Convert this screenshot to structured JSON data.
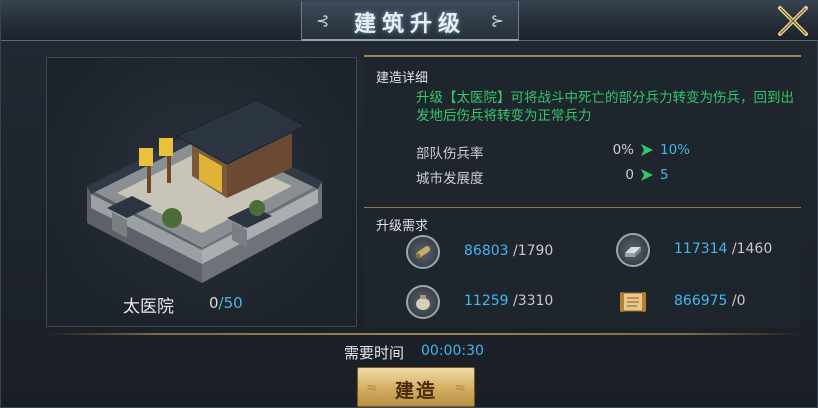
{
  "window": {
    "title": "建筑升级",
    "close_icon": "close-x-icon"
  },
  "building": {
    "name": "太医院",
    "level_current": "0",
    "level_separator": "/",
    "level_max": "50"
  },
  "details": {
    "header": "建造详细",
    "description": "升级【太医院】可将战斗中死亡的部分兵力转变为伤兵，回到出发地后伤兵将转变为正常兵力",
    "stats": [
      {
        "label": "部队伤兵率",
        "from": "0%",
        "to": "10%"
      },
      {
        "label": "城市发展度",
        "from": "0",
        "to": "5"
      }
    ]
  },
  "requirements": {
    "header": "升级需求",
    "items": [
      {
        "icon": "wood-log-icon",
        "have": "86803",
        "need": " /1790"
      },
      {
        "icon": "iron-ingot-icon",
        "have": "117314",
        "need": " /1460"
      },
      {
        "icon": "grain-sack-icon",
        "have": "11259",
        "need": " /3310"
      },
      {
        "icon": "gold-scroll-icon",
        "have": "866975",
        "need": " /0"
      }
    ]
  },
  "footer": {
    "time_label": "需要时间",
    "time_value": "00:00:30",
    "build_button": "建造"
  },
  "colors": {
    "highlight_blue": "#40b7ee",
    "desc_green": "#33c76a",
    "gold_line": "#9a8352"
  }
}
